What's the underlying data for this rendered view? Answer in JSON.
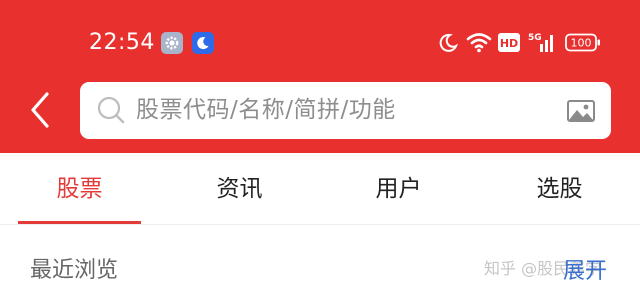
{
  "status_bar": {
    "time": "22:54",
    "icons": [
      "gear-icon",
      "moon-badge-icon",
      "moon-icon",
      "wifi-icon",
      "hd-icon",
      "5g-signal-icon",
      "battery-icon"
    ],
    "network": "5G",
    "hd_label": "HD",
    "battery_label": "100"
  },
  "header": {
    "background_color": "#E8312F",
    "search_placeholder": "股票代码/名称/简拼/功能"
  },
  "tabs": [
    {
      "label": "股票",
      "active": true
    },
    {
      "label": "资讯",
      "active": false
    },
    {
      "label": "用户",
      "active": false
    },
    {
      "label": "选股",
      "active": false
    }
  ],
  "accent_color": "#E33B3A",
  "section": {
    "title": "最近浏览",
    "action_label": "展开"
  },
  "watermark": "知乎 @股民养学"
}
